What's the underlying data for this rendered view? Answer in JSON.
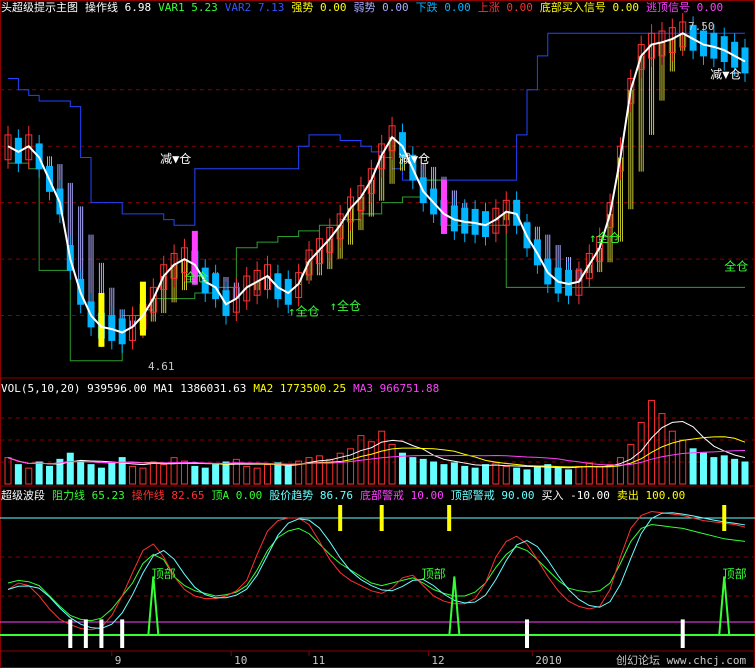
{
  "colors": {
    "bg": "#000000",
    "up": "#ff3030",
    "down": "#00b4ff",
    "yellow": "#ffff00",
    "green": "#33ff33",
    "magenta": "#ff40ff",
    "white": "#ffffff",
    "blue": "#2244ff",
    "gray": "#c8c8c8",
    "cyan": "#66ffff",
    "olive": "#c8c832",
    "lavender": "#aaaaff"
  },
  "header": {
    "items": [
      {
        "text": "头超级提示主图",
        "color": "#ffffff"
      },
      {
        "text": "操作线 6.98",
        "color": "#ffffff"
      },
      {
        "text": "VAR1 5.23",
        "color": "#33ff33"
      },
      {
        "text": "VAR2 7.13",
        "color": "#3355ff"
      },
      {
        "text": "强势 0.00",
        "color": "#ffff00"
      },
      {
        "text": "弱势 0.00",
        "color": "#aaaaff"
      },
      {
        "text": "下跌 0.00",
        "color": "#00b4ff"
      },
      {
        "text": "上涨 0.00",
        "color": "#ff3030"
      },
      {
        "text": "底部买入信号 0.00",
        "color": "#ffff00"
      },
      {
        "text": "逃顶信号 0.00",
        "color": "#ff40ff"
      }
    ]
  },
  "vol_header": {
    "items": [
      {
        "text": "VOL(5,10,20) 939596.00",
        "color": "#ffffff"
      },
      {
        "text": "MA1 1386031.63",
        "color": "#ffffff"
      },
      {
        "text": "MA2 1773500.25",
        "color": "#ffff00"
      },
      {
        "text": "MA3 966751.88",
        "color": "#ff40ff"
      }
    ]
  },
  "osc_header": {
    "items": [
      {
        "text": "超级波段",
        "color": "#ffffff"
      },
      {
        "text": "阻力线 65.23",
        "color": "#33ff33"
      },
      {
        "text": "操作线 82.65",
        "color": "#ff3030"
      },
      {
        "text": "顶A 0.00",
        "color": "#33ff33"
      },
      {
        "text": "股价趋势 86.76",
        "color": "#66ffff"
      },
      {
        "text": "底部警戒 10.00",
        "color": "#ff40ff"
      },
      {
        "text": "顶部警戒 90.00",
        "color": "#66ffff"
      },
      {
        "text": "买入 -10.00",
        "color": "#ffffff"
      },
      {
        "text": "卖出 100.00",
        "color": "#ffff00"
      }
    ]
  },
  "annotations": {
    "high": "7.50",
    "low": "4.61",
    "reduce": "减▼仓",
    "full": "全仓",
    "top": "顶部",
    "arrow": "↑"
  },
  "footer": {
    "watermark": "创幻论坛 www.chcj.com"
  },
  "chart_data": [
    {
      "type": "candlestick",
      "title": "",
      "y_range": [
        4.5,
        7.6
      ],
      "x": [
        0,
        2,
        4,
        6,
        8,
        10,
        12,
        14,
        16,
        18,
        20,
        22,
        24,
        26,
        28,
        30,
        32,
        34,
        36,
        38,
        40,
        42,
        44,
        46,
        48,
        50,
        52,
        54,
        56,
        58,
        60,
        62,
        64,
        66,
        68,
        70,
        72,
        74,
        76,
        78,
        80,
        82,
        84,
        86,
        88,
        90,
        92,
        94,
        96,
        98,
        100,
        102,
        104,
        106,
        108,
        110,
        112,
        114,
        116,
        118,
        120,
        122,
        124,
        126,
        128,
        130,
        132,
        134,
        136,
        138,
        140,
        142
      ],
      "price_line": [
        6.5,
        6.45,
        6.5,
        6.4,
        6.2,
        6.0,
        5.5,
        5.2,
        5.0,
        4.9,
        4.88,
        4.85,
        4.9,
        5.0,
        5.15,
        5.35,
        5.45,
        5.5,
        5.45,
        5.3,
        5.25,
        5.1,
        5.15,
        5.25,
        5.3,
        5.35,
        5.25,
        5.2,
        5.28,
        5.48,
        5.58,
        5.68,
        5.8,
        5.95,
        6.05,
        6.2,
        6.42,
        6.58,
        6.5,
        6.3,
        6.1,
        6.0,
        5.9,
        5.85,
        5.83,
        5.82,
        5.8,
        5.85,
        5.92,
        5.9,
        5.7,
        5.55,
        5.38,
        5.3,
        5.28,
        5.3,
        5.45,
        5.6,
        5.9,
        6.4,
        7.0,
        7.3,
        7.4,
        7.42,
        7.45,
        7.5,
        7.45,
        7.4,
        7.38,
        7.35,
        7.3,
        7.25
      ],
      "upper_band": [
        7.1,
        7.0,
        6.95,
        6.9,
        6.9,
        6.9,
        6.85,
        6.4,
        6.0,
        6.0,
        6.0,
        5.9,
        5.9,
        5.9,
        5.9,
        5.85,
        5.8,
        5.8,
        6.3,
        6.3,
        6.3,
        6.3,
        6.3,
        6.3,
        6.3,
        6.3,
        6.3,
        6.3,
        6.5,
        6.6,
        6.6,
        6.6,
        6.55,
        6.55,
        6.5,
        6.45,
        6.4,
        6.3,
        6.2,
        6.2,
        6.2,
        6.2,
        6.2,
        6.2,
        6.2,
        6.2,
        6.2,
        6.2,
        6.2,
        6.6,
        7.0,
        7.3,
        7.5,
        7.5,
        7.5,
        7.5,
        7.5,
        7.5,
        7.5,
        7.5,
        7.5,
        7.5,
        7.5,
        7.5,
        7.5,
        7.5,
        7.5,
        7.5,
        7.5,
        7.5,
        7.5,
        7.5
      ],
      "lower_band": [
        6.35,
        6.35,
        6.3,
        5.4,
        5.4,
        5.4,
        4.6,
        4.6,
        4.6,
        4.6,
        4.6,
        5.0,
        5.0,
        5.05,
        5.15,
        5.15,
        5.15,
        5.15,
        5.2,
        5.2,
        5.25,
        5.25,
        5.6,
        5.6,
        5.65,
        5.65,
        5.7,
        5.7,
        5.75,
        5.75,
        5.8,
        5.8,
        5.85,
        5.85,
        5.9,
        5.9,
        6.0,
        6.0,
        6.05,
        6.05,
        6.2,
        6.2,
        5.8,
        5.8,
        5.8,
        5.8,
        5.8,
        5.8,
        5.25,
        5.25,
        5.25,
        5.25,
        5.25,
        5.25,
        5.25,
        5.25,
        5.25,
        5.25,
        5.25,
        5.25,
        5.25,
        5.25,
        5.25,
        5.25,
        5.25,
        5.25,
        5.25,
        5.25,
        5.25,
        5.25,
        5.25,
        5.25
      ]
    },
    {
      "type": "bar",
      "title": "VOL(5,10,20)",
      "y_range": [
        0,
        100
      ],
      "x": [
        0,
        2,
        4,
        6,
        8,
        10,
        12,
        14,
        16,
        18,
        20,
        22,
        24,
        26,
        28,
        30,
        32,
        34,
        36,
        38,
        40,
        42,
        44,
        46,
        48,
        50,
        52,
        54,
        56,
        58,
        60,
        62,
        64,
        66,
        68,
        70,
        72,
        74,
        76,
        78,
        80,
        82,
        84,
        86,
        88,
        90,
        92,
        94,
        96,
        98,
        100,
        102,
        104,
        106,
        108,
        110,
        112,
        114,
        116,
        118,
        120,
        122,
        124,
        126,
        128,
        130,
        132,
        134,
        136,
        138,
        140,
        142
      ],
      "values": [
        30,
        22,
        18,
        25,
        20,
        28,
        35,
        26,
        22,
        18,
        24,
        30,
        20,
        18,
        25,
        22,
        30,
        26,
        20,
        18,
        22,
        25,
        28,
        20,
        18,
        22,
        24,
        20,
        26,
        30,
        32,
        28,
        35,
        40,
        55,
        48,
        60,
        45,
        35,
        30,
        28,
        25,
        22,
        24,
        20,
        18,
        22,
        24,
        20,
        18,
        16,
        20,
        22,
        18,
        16,
        20,
        24,
        20,
        22,
        30,
        45,
        70,
        95,
        80,
        60,
        50,
        40,
        35,
        30,
        32,
        28,
        25
      ]
    },
    {
      "type": "line",
      "title": "超级波段",
      "y_range": [
        -10,
        100
      ],
      "x": [
        0,
        2,
        4,
        6,
        8,
        10,
        12,
        14,
        16,
        18,
        20,
        22,
        24,
        26,
        28,
        30,
        32,
        34,
        36,
        38,
        40,
        42,
        44,
        46,
        48,
        50,
        52,
        54,
        56,
        58,
        60,
        62,
        64,
        66,
        68,
        70,
        72,
        74,
        76,
        78,
        80,
        82,
        84,
        86,
        88,
        90,
        92,
        94,
        96,
        98,
        100,
        102,
        104,
        106,
        108,
        110,
        112,
        114,
        116,
        118,
        120,
        122,
        124,
        126,
        128,
        130,
        132,
        134,
        136,
        138,
        140,
        142
      ],
      "series": [
        {
          "name": "阻力线",
          "values": [
            40,
            42,
            41,
            38,
            30,
            22,
            15,
            12,
            11,
            13,
            20,
            30,
            40,
            55,
            62,
            58,
            45,
            38,
            34,
            32,
            30,
            31,
            33,
            38,
            50,
            65,
            75,
            80,
            82,
            78,
            70,
            62,
            55,
            50,
            45,
            40,
            38,
            40,
            42,
            44,
            40,
            35,
            32,
            30,
            30,
            33,
            40,
            52,
            62,
            68,
            65,
            58,
            50,
            42,
            36,
            34,
            33,
            34,
            40,
            55,
            72,
            82,
            85,
            84,
            83,
            82,
            80,
            78,
            76,
            74,
            73,
            72
          ]
        },
        {
          "name": "操作线",
          "values": [
            35,
            40,
            38,
            30,
            20,
            12,
            8,
            5,
            4,
            6,
            15,
            30,
            48,
            65,
            70,
            60,
            45,
            35,
            30,
            28,
            28,
            30,
            34,
            42,
            62,
            80,
            88,
            90,
            90,
            85,
            72,
            58,
            48,
            42,
            38,
            34,
            32,
            36,
            44,
            46,
            38,
            30,
            26,
            24,
            24,
            28,
            40,
            60,
            72,
            76,
            70,
            58,
            45,
            34,
            26,
            22,
            20,
            22,
            35,
            60,
            82,
            92,
            95,
            94,
            93,
            92,
            90,
            88,
            87,
            86,
            85,
            83
          ]
        }
      ]
    }
  ]
}
